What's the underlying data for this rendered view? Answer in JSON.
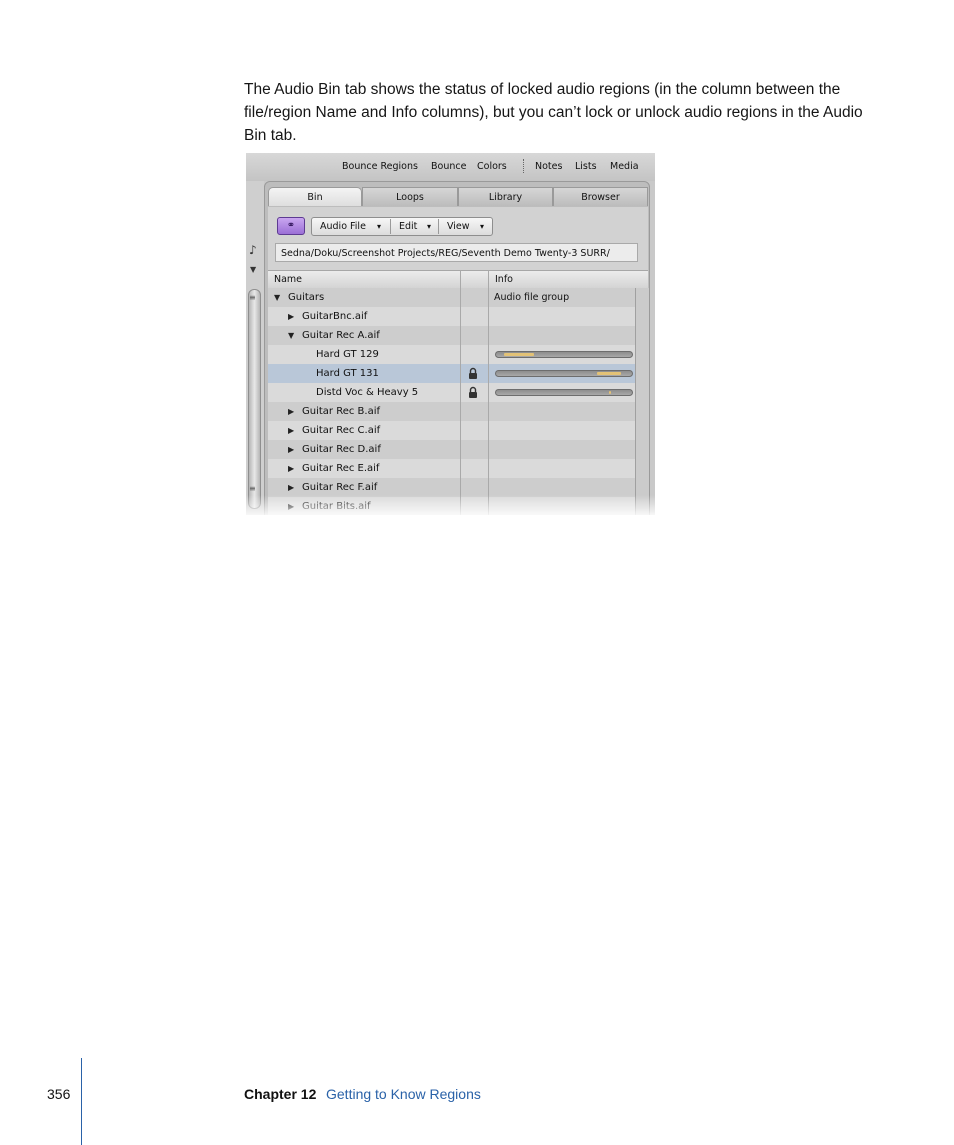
{
  "body_text": "The Audio Bin tab shows the status of locked audio regions (in the column between the file/region Name and Info columns), but you can’t lock or unlock audio regions in the Audio Bin tab.",
  "toolbar": {
    "items": [
      "Bounce Regions",
      "Bounce",
      "Colors",
      "Notes",
      "Lists",
      "Media"
    ]
  },
  "tabs": [
    "Bin",
    "Loops",
    "Library",
    "Browser"
  ],
  "active_tab": "Bin",
  "bin_menu": {
    "audio_file": "Audio File",
    "edit": "Edit",
    "view": "View",
    "arrow": "▾"
  },
  "link_icon": "link-icon",
  "path": "Sedna/Doku/Screenshot Projects/REG/Seventh Demo Twenty-3 SURR/",
  "columns": {
    "name": "Name",
    "info": "Info"
  },
  "rows": [
    {
      "name": "Guitars",
      "disclosure": "▼",
      "info": "Audio file group",
      "locked": false,
      "level": 0
    },
    {
      "name": "GuitarBnc.aif",
      "disclosure": "▶",
      "info": "",
      "locked": false,
      "level": 1
    },
    {
      "name": "Guitar Rec A.aif",
      "disclosure": "▼",
      "info": "",
      "locked": false,
      "level": 1
    },
    {
      "name": "Hard GT 129",
      "disclosure": "",
      "info": "",
      "locked": false,
      "level": 2,
      "bar_start": 0.06,
      "bar_end": 0.28
    },
    {
      "name": "Hard GT 131",
      "disclosure": "",
      "info": "",
      "locked": true,
      "level": 2,
      "selected": true,
      "bar_start": 0.74,
      "bar_end": 0.92
    },
    {
      "name": "Distd Voc & Heavy 5",
      "disclosure": "",
      "info": "",
      "locked": true,
      "level": 2,
      "bar_start": 0.83,
      "bar_end": 0.845
    },
    {
      "name": "Guitar Rec B.aif",
      "disclosure": "▶",
      "info": "",
      "locked": false,
      "level": 1
    },
    {
      "name": "Guitar Rec C.aif",
      "disclosure": "▶",
      "info": "",
      "locked": false,
      "level": 1
    },
    {
      "name": "Guitar Rec D.aif",
      "disclosure": "▶",
      "info": "",
      "locked": false,
      "level": 1
    },
    {
      "name": "Guitar Rec E.aif",
      "disclosure": "▶",
      "info": "",
      "locked": false,
      "level": 1
    },
    {
      "name": "Guitar Rec F.aif",
      "disclosure": "▶",
      "info": "",
      "locked": false,
      "level": 1
    },
    {
      "name": "Guitar Bits.aif",
      "disclosure": "▶",
      "info": "",
      "locked": false,
      "level": 1
    }
  ],
  "colors": {
    "link_button": "#9b6fd6",
    "region_bar_fill": "#e3c276",
    "selected_row": "#b9c7d8",
    "footer_accent": "#2a62a8"
  },
  "footer": {
    "page_number": "356",
    "chapter": "Chapter 12",
    "chapter_title": "Getting to Know Regions"
  }
}
